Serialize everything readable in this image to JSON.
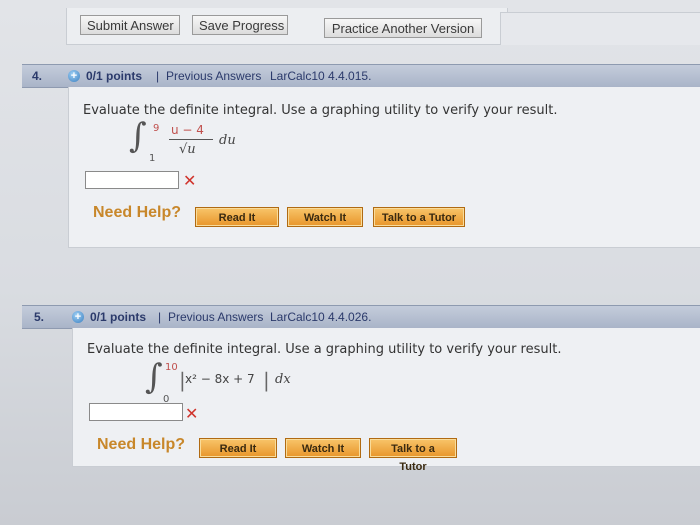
{
  "toolbar": {
    "submit_label": "Submit Answer",
    "save_label": "Save Progress",
    "practice_label": "Practice Another Version"
  },
  "questions": [
    {
      "number": "4.",
      "points": "0/1 points",
      "separator": "|",
      "previous_answers": "Previous Answers",
      "reference": "LarCalc10 4.4.015.",
      "prompt": "Evaluate the definite integral. Use a graphing utility to verify your result.",
      "integral": {
        "upper": "9",
        "lower": "1",
        "numerator": "u − 4",
        "denominator": "√u",
        "differential": "du"
      },
      "answer_value": "",
      "result_icon": "x-mark-icon",
      "need_help": "Need Help?",
      "help_buttons": [
        "Read It",
        "Watch It",
        "Talk to a Tutor"
      ]
    },
    {
      "number": "5.",
      "points": "0/1 points",
      "separator": "|",
      "previous_answers": "Previous Answers",
      "reference": "LarCalc10 4.4.026.",
      "prompt": "Evaluate the definite integral. Use a graphing utility to verify your result.",
      "integral": {
        "upper": "10",
        "lower": "0",
        "integrand": "x² − 8x + 7",
        "differential": "dx"
      },
      "answer_value": "",
      "result_icon": "x-mark-icon",
      "need_help": "Need Help?",
      "help_buttons": [
        "Read It",
        "Watch It",
        "Talk to a Tutor"
      ]
    }
  ],
  "colors": {
    "accent_orange": "#e8952a",
    "header_blue": "#2b3a6b",
    "error_red": "#d0342c"
  }
}
